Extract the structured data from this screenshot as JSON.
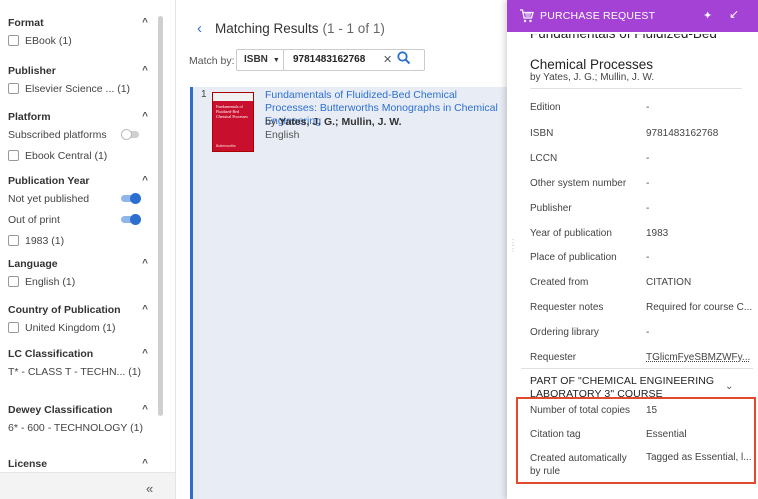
{
  "sidebar": {
    "facets": [
      {
        "title": "Format",
        "rows": [
          {
            "type": "checkbox",
            "label": "EBook (1)"
          }
        ]
      },
      {
        "title": "Publisher",
        "rows": [
          {
            "type": "checkbox",
            "label": "Elsevier Science ...  (1)"
          }
        ]
      },
      {
        "title": "Platform",
        "rows": [
          {
            "type": "toggle-off",
            "label": "Subscribed platforms"
          },
          {
            "type": "checkbox",
            "label": "Ebook Central (1)"
          }
        ]
      },
      {
        "title": "Publication Year",
        "rows": [
          {
            "type": "toggle-on",
            "label": "Not yet published"
          },
          {
            "type": "toggle-on",
            "label": "Out of print"
          },
          {
            "type": "checkbox",
            "label": "1983 (1)"
          }
        ]
      },
      {
        "title": "Language",
        "rows": [
          {
            "type": "checkbox",
            "label": "English (1)"
          }
        ]
      },
      {
        "title": "Country of Publication",
        "rows": [
          {
            "type": "checkbox",
            "label": "United Kingdom (1)"
          }
        ]
      },
      {
        "title": "LC Classification",
        "rows": [
          {
            "type": "text",
            "label": "T* - CLASS T - TECHN...  (1)"
          }
        ]
      },
      {
        "title": "Dewey Classification",
        "rows": [
          {
            "type": "text",
            "label": "6* - 600 - TECHNOLOGY (1)"
          }
        ]
      },
      {
        "title": "License",
        "rows": []
      }
    ],
    "collapse_label": "«"
  },
  "main": {
    "title": "Matching Results",
    "count": "(1 - 1 of 1)",
    "match_label": "Match by:",
    "match_field": "ISBN",
    "isbn_value": "9781483162768",
    "result": {
      "number": "1",
      "title": "Fundamentals of Fluidized-Bed Chemical Processes: Butterworths Monographs in Chemical Engineering",
      "by_prefix": "by",
      "authors": "Yates, J. G.; Mullin, J. W.",
      "language": "English",
      "cover_title": "Fundamentals of Fluidized-Bed Chemical Processes",
      "cover_author": "J. G. Yates",
      "cover_footer": "Butterworths"
    }
  },
  "panel": {
    "header": "PURCHASE REQUEST",
    "title_top": "Fundamentals of Fluidized-Bed",
    "title": "Chemical Processes",
    "by": "by Yates, J. G.; Mullin, J. W.",
    "fields": [
      {
        "label": "Edition",
        "value": "-"
      },
      {
        "label": "ISBN",
        "value": "9781483162768"
      },
      {
        "label": "LCCN",
        "value": "-"
      },
      {
        "label": "Other system number",
        "value": "-"
      },
      {
        "label": "Publisher",
        "value": "-"
      },
      {
        "label": "Year of publication",
        "value": "1983"
      },
      {
        "label": "Place of publication",
        "value": "-"
      },
      {
        "label": "Created from",
        "value": "CITATION"
      },
      {
        "label": "Requester notes",
        "value": "Required for course C..."
      },
      {
        "label": "Ordering library",
        "value": "-"
      },
      {
        "label": "Requester",
        "value": "TGlicmFyeSBMZWFy..."
      }
    ],
    "part_title": "PART OF \"CHEMICAL ENGINEERING LABORATORY 3\" COURSE",
    "part_fields": [
      {
        "label": "Number of total copies",
        "value": "15"
      },
      {
        "label": "Citation tag",
        "value": "Essential"
      },
      {
        "label": "Created automatically by rule",
        "value": "Tagged as Essential, l..."
      }
    ]
  },
  "colors": {
    "accent": "#2d6fd1",
    "panel_header": "#a442d6",
    "highlight": "#e24a2c"
  }
}
